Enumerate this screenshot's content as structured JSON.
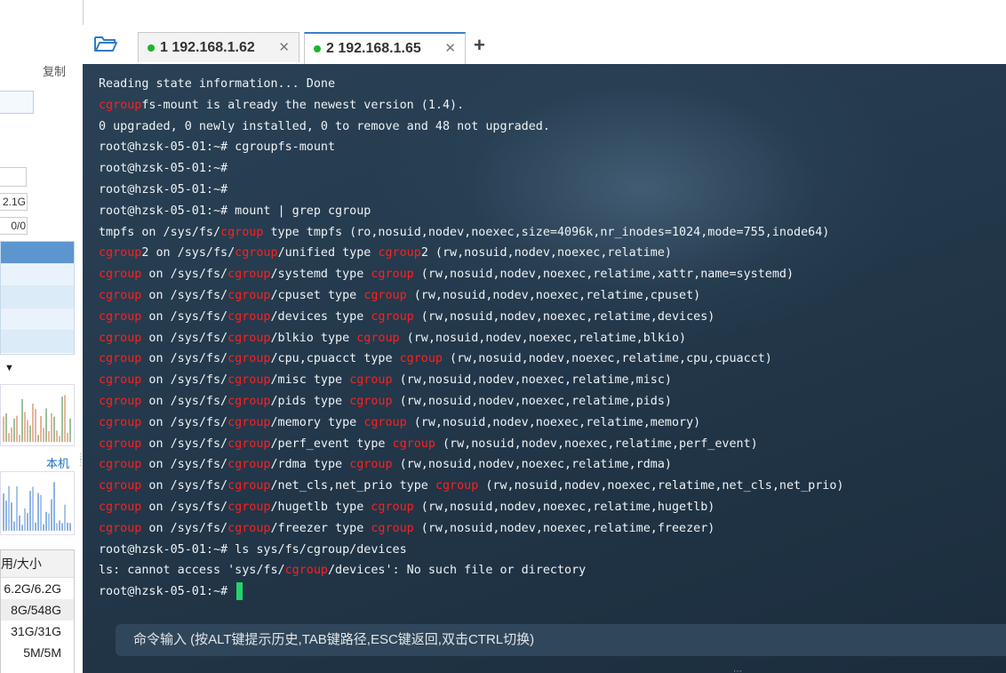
{
  "left_panel": {
    "copy_label": "复制",
    "values": [
      "2.1G",
      "0/0"
    ],
    "local_label": "本机",
    "disk_table": {
      "header": "用/大小",
      "rows": [
        "6.2G/6.2G",
        "8G/548G",
        "31G/31G",
        "5M/5M"
      ]
    }
  },
  "tabs": [
    {
      "label": "1 192.168.1.62",
      "status_color": "#1cb52a",
      "active": false
    },
    {
      "label": "2 192.168.1.65",
      "status_color": "#1cb52a",
      "active": true
    }
  ],
  "terminal": {
    "highlight_word": "cgroup",
    "highlight_color": "#ff1f1f",
    "cursor_color": "#21d46a",
    "lines": [
      "Reading state information... Done",
      "cgroupfs-mount is already the newest version (1.4).",
      "0 upgraded, 0 newly installed, 0 to remove and 48 not upgraded.",
      "root@hzsk-05-01:~# cgroupfs-mount",
      "root@hzsk-05-01:~#",
      "root@hzsk-05-01:~#",
      "root@hzsk-05-01:~# mount | grep cgroup",
      "tmpfs on /sys/fs/cgroup type tmpfs (ro,nosuid,nodev,noexec,size=4096k,nr_inodes=1024,mode=755,inode64)",
      "cgroup2 on /sys/fs/cgroup/unified type cgroup2 (rw,nosuid,nodev,noexec,relatime)",
      "cgroup on /sys/fs/cgroup/systemd type cgroup (rw,nosuid,nodev,noexec,relatime,xattr,name=systemd)",
      "cgroup on /sys/fs/cgroup/cpuset type cgroup (rw,nosuid,nodev,noexec,relatime,cpuset)",
      "cgroup on /sys/fs/cgroup/devices type cgroup (rw,nosuid,nodev,noexec,relatime,devices)",
      "cgroup on /sys/fs/cgroup/blkio type cgroup (rw,nosuid,nodev,noexec,relatime,blkio)",
      "cgroup on /sys/fs/cgroup/cpu,cpuacct type cgroup (rw,nosuid,nodev,noexec,relatime,cpu,cpuacct)",
      "cgroup on /sys/fs/cgroup/misc type cgroup (rw,nosuid,nodev,noexec,relatime,misc)",
      "cgroup on /sys/fs/cgroup/pids type cgroup (rw,nosuid,nodev,noexec,relatime,pids)",
      "cgroup on /sys/fs/cgroup/memory type cgroup (rw,nosuid,nodev,noexec,relatime,memory)",
      "cgroup on /sys/fs/cgroup/perf_event type cgroup (rw,nosuid,nodev,noexec,relatime,perf_event)",
      "cgroup on /sys/fs/cgroup/rdma type cgroup (rw,nosuid,nodev,noexec,relatime,rdma)",
      "cgroup on /sys/fs/cgroup/net_cls,net_prio type cgroup (rw,nosuid,nodev,noexec,relatime,net_cls,net_prio)",
      "cgroup on /sys/fs/cgroup/hugetlb type cgroup (rw,nosuid,nodev,noexec,relatime,hugetlb)",
      "cgroup on /sys/fs/cgroup/freezer type cgroup (rw,nosuid,nodev,noexec,relatime,freezer)",
      "root@hzsk-05-01:~# ls sys/fs/cgroup/devices",
      "ls: cannot access 'sys/fs/cgroup/devices': No such file or directory",
      "root@hzsk-05-01:~#"
    ]
  },
  "command_input": {
    "placeholder": "命令输入 (按ALT键提示历史,TAB键路径,ESC键返回,双击CTRL切换)"
  }
}
